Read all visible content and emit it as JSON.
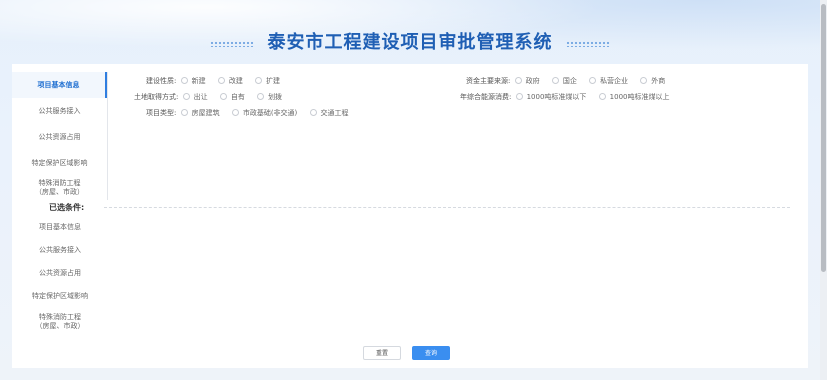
{
  "header": {
    "title": "泰安市工程建设项目审批管理系统"
  },
  "sidebar": {
    "items": [
      {
        "label": "项目基本信息",
        "active": true
      },
      {
        "label": "公共服务接入"
      },
      {
        "label": "公共资源占用"
      },
      {
        "label": "特定保护区域影响"
      },
      {
        "label_line1": "特殊消防工程",
        "label_line2": "（房屋、市政）"
      }
    ]
  },
  "filters": {
    "construction_nature": {
      "label": "建设性质:",
      "options": [
        "新建",
        "改建",
        "扩建"
      ]
    },
    "land_method": {
      "label": "土地取得方式:",
      "options": [
        "出让",
        "自有",
        "划拨"
      ]
    },
    "project_type": {
      "label": "项目类型:",
      "options": [
        "房屋建筑",
        "市政基础(非交通)",
        "交通工程"
      ]
    },
    "fund_source": {
      "label": "资金主要来源:",
      "options": [
        "政府",
        "国企",
        "私营企业",
        "外商"
      ]
    },
    "energy": {
      "label": "年综合能源消费:",
      "options": [
        "1000吨标准煤以下",
        "1000吨标准煤以上"
      ]
    }
  },
  "selected": {
    "title": "已选条件:",
    "items": [
      {
        "label": "项目基本信息"
      },
      {
        "label": "公共服务接入"
      },
      {
        "label": "公共资源占用"
      },
      {
        "label": "特定保护区域影响"
      },
      {
        "label_line1": "特殊消防工程",
        "label_line2": "（房屋、市政）"
      }
    ]
  },
  "buttons": {
    "reset": "重置",
    "query": "查询"
  },
  "colors": {
    "accent": "#3a8ef0",
    "title": "#1f5fb4"
  }
}
